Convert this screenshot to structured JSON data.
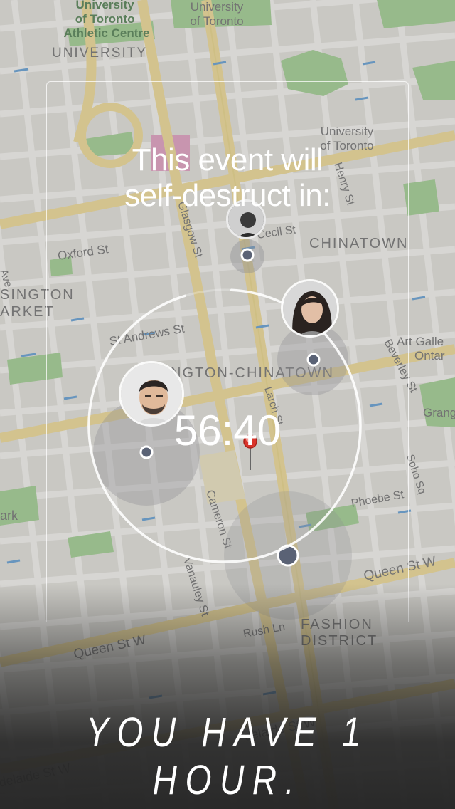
{
  "map": {
    "labels": {
      "uoft_athletic": "University\nof Toronto\nAthletic Centre",
      "uoft_top": "University\nof Toronto",
      "university": "UNIVERSITY",
      "uoft_right": "University\nof Toronto",
      "henry_st": "Henry St",
      "chinatown": "CHINATOWN",
      "oxford_st": "Oxford St",
      "cecil_st": "Cecil St",
      "glasgow_st": "Glasgow St",
      "beverley_st_top": "Beverley St",
      "kensington": "SINGTON\nARKET",
      "st_andrews": "St Andrews St",
      "kensington_chinatown": "NGTON-CHINATOWN",
      "beverley_st": "Beverley St",
      "art_gallery": "Art Galle\nOntar",
      "grange": "Grang",
      "larch_st": "Larch St",
      "soho_sq": "Soho Sq",
      "phoebe_st": "Phoebe St",
      "cameron_st": "Cameron St",
      "vanauley_st": "Vanauley St",
      "queen_st_w_right": "Queen St W",
      "queen_st_w_left": "Queen St W",
      "rush_ln": "Rush Ln",
      "fashion_district": "FASHION\nDISTRICT",
      "adelaide_left": "delaide St W",
      "adelaide_mid": "delaide St W",
      "park": "ark",
      "ave": "Ave"
    },
    "colors": {
      "base": "#e6e4df",
      "road": "#f7f6f2",
      "arterial": "#f2df9e",
      "park": "#a9d39a",
      "water_blue": "#6ea6d8",
      "label": "#7d7d7d"
    }
  },
  "event": {
    "headline": "This event will\nself-destruct in:",
    "timer": "56:40",
    "remaining_fraction": 0.945
  },
  "tagline": "YOU HAVE 1 HOUR."
}
